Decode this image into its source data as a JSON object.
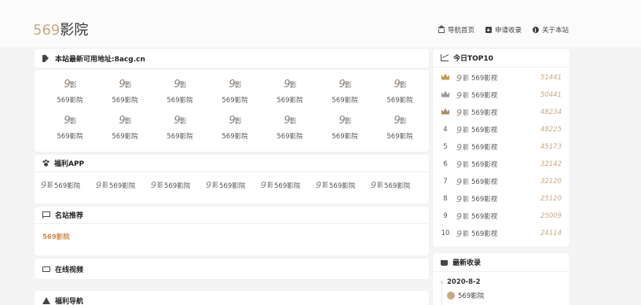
{
  "header": {
    "logo_num": "569",
    "logo_text": "影院",
    "nav": [
      {
        "label": "导航首页",
        "icon": "home-icon"
      },
      {
        "label": "申请收录",
        "icon": "plus-square-icon"
      },
      {
        "label": "关于本站",
        "icon": "info-circle-icon"
      }
    ]
  },
  "notice": {
    "text": "本站最新可用地址:8acg.cn",
    "icon": "bullhorn-icon"
  },
  "grid": {
    "badge_num": "9",
    "badge_kanji": "影",
    "items": [
      "569影院",
      "569影院",
      "569影院",
      "569影院",
      "569影院",
      "569影院",
      "569影院",
      "569影院",
      "569影院",
      "569影院",
      "569影院",
      "569影院",
      "569影院",
      "569影院"
    ]
  },
  "welfare": {
    "title": "福利APP",
    "icon": "paw-icon",
    "badge_num": "9",
    "badge_kanji": "影",
    "items": [
      "569影院",
      "569影院",
      "569影院",
      "569影院",
      "569影院",
      "569影院",
      "569影院"
    ]
  },
  "recommend": {
    "title": "名站推荐",
    "icon": "flag-icon",
    "link": "569影院"
  },
  "video": {
    "title": "在线视频",
    "icon": "monitor-icon"
  },
  "nav2": {
    "title": "福利导航",
    "icon": "location-arrow-icon"
  },
  "top10": {
    "title": "今日TOP10",
    "icon": "line-chart-icon",
    "badge_num": "9",
    "badge_kanji": "影",
    "rows": [
      {
        "rank": "",
        "medal": "gold",
        "name": "569影视",
        "count": "51441"
      },
      {
        "rank": "",
        "medal": "silver",
        "name": "569影视",
        "count": "50441"
      },
      {
        "rank": "",
        "medal": "bronze",
        "name": "569影视",
        "count": "48234"
      },
      {
        "rank": "4",
        "medal": "",
        "name": "569影视",
        "count": "48225"
      },
      {
        "rank": "5",
        "medal": "",
        "name": "569影视",
        "count": "45173"
      },
      {
        "rank": "6",
        "medal": "",
        "name": "569影视",
        "count": "32142"
      },
      {
        "rank": "7",
        "medal": "",
        "name": "569影视",
        "count": "32120"
      },
      {
        "rank": "8",
        "medal": "",
        "name": "569影视",
        "count": "25120"
      },
      {
        "rank": "9",
        "medal": "",
        "name": "569影视",
        "count": "25009"
      },
      {
        "rank": "10",
        "medal": "",
        "name": "569影视",
        "count": "24114"
      }
    ]
  },
  "latest": {
    "title": "最新收录",
    "icon": "coffee-icon",
    "date": "2020-8-2",
    "item": "569影院"
  }
}
